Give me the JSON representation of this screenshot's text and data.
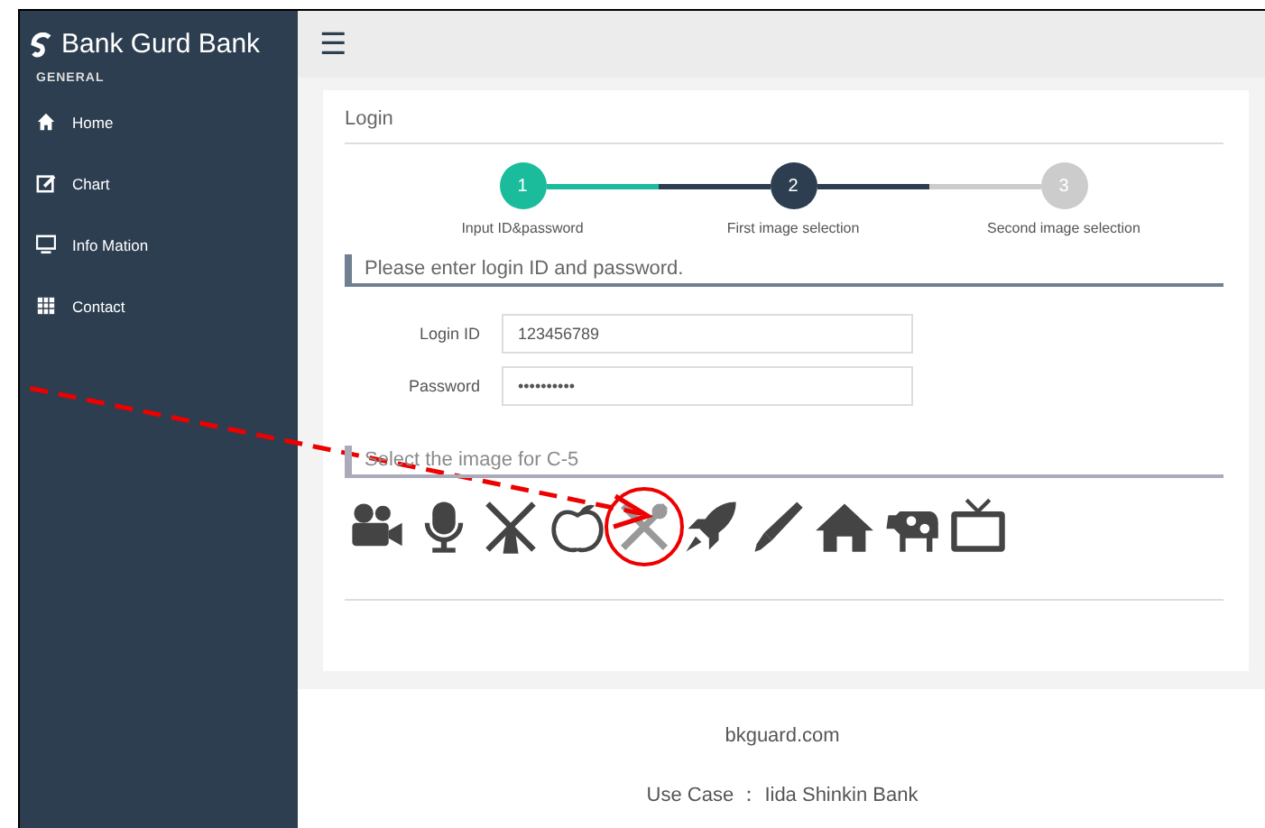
{
  "sidebar": {
    "brand": "Bank Gurd Bank",
    "section": "GENERAL",
    "items": [
      {
        "label": "Home",
        "kind": "home"
      },
      {
        "label": "Chart",
        "kind": "edit"
      },
      {
        "label": "Info Mation",
        "kind": "monitor"
      },
      {
        "label": "Contact",
        "kind": "table"
      }
    ]
  },
  "topbar": {
    "menu_icon": "☰"
  },
  "panel": {
    "title": "Login",
    "steps": [
      {
        "number": "1",
        "label": "Input ID&password",
        "completed": true,
        "selected": false
      },
      {
        "number": "2",
        "label": "First image selection",
        "completed": false,
        "selected": true
      },
      {
        "number": "3",
        "label": "Second image selection",
        "completed": false,
        "selected": false
      }
    ],
    "form_heading": "Please enter login ID and password.",
    "fields": [
      {
        "label": "Login ID",
        "value": "123456789"
      },
      {
        "label": "Password",
        "value": "••••••••••"
      }
    ],
    "image_heading": "Select the image for C-5",
    "images": [
      {
        "kind": "video-camera",
        "selected": false
      },
      {
        "kind": "microphone",
        "selected": false
      },
      {
        "kind": "windmill",
        "selected": false
      },
      {
        "kind": "peach",
        "selected": false
      },
      {
        "kind": "tools",
        "selected": true
      },
      {
        "kind": "rocket",
        "selected": false
      },
      {
        "kind": "pen",
        "selected": false
      },
      {
        "kind": "house",
        "selected": false
      },
      {
        "kind": "cow",
        "selected": false
      },
      {
        "kind": "tv",
        "selected": false
      }
    ]
  },
  "footer": {
    "site": "bkguard.com",
    "use_case": "Use Case  ：  Iida Shinkin Bank"
  },
  "annotation": {
    "arrow": true
  }
}
